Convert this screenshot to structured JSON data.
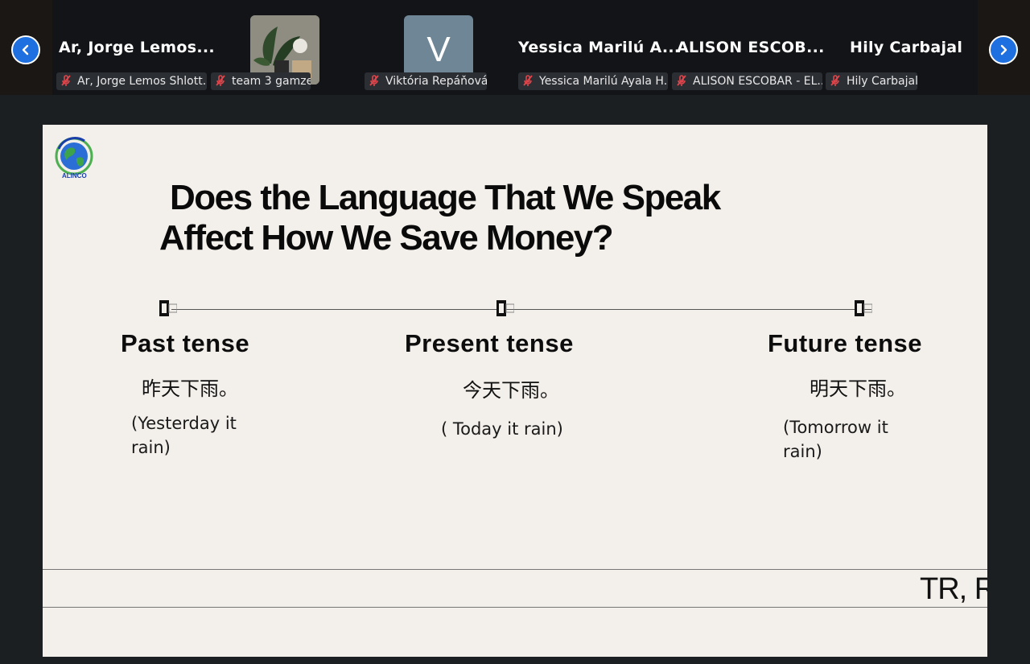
{
  "participants": {
    "nav": {
      "prev_icon": "chevron-left-icon",
      "next_icon": "chevron-right-icon"
    },
    "tiles": [
      {
        "name": "Ar, Jorge Lemos...",
        "label": "Ar, Jorge Lemos Shlott..."
      },
      {
        "name": "",
        "label": "team 3 gamze"
      },
      {
        "name": "",
        "avatar_letter": "V",
        "label": "Viktória Repáňová"
      },
      {
        "name": "Yessica Marilú A...",
        "label": "Yessica Marilú Ayala H..."
      },
      {
        "name": "ALISON ESCOB...",
        "label": "ALISON ESCOBAR - EL..."
      },
      {
        "name": "Hily Carbajal",
        "label": "Hily Carbajal"
      }
    ],
    "colors": {
      "nav_button": "#1e6fe0",
      "muted_mic": "#e0454b",
      "avatar_bg": "#6f8696"
    }
  },
  "slide": {
    "logo_text": "ALINCO",
    "title_line1": "Does the Language That We Speak",
    "title_line2": "Affect How We Save Money?",
    "tenses": [
      {
        "heading": "Past tense",
        "chinese": "昨天下雨。",
        "english_line1": "(Yesterday it",
        "english_line2": "rain)"
      },
      {
        "heading": "Present tense",
        "chinese": "今天下雨。",
        "english_line1": "( Today it rain)",
        "english_line2": ""
      },
      {
        "heading": "Future tense",
        "chinese": "明天下雨。",
        "english_line1": "(Tomorrow it",
        "english_line2": "rain)"
      }
    ],
    "ticker_text": "TR, R"
  }
}
